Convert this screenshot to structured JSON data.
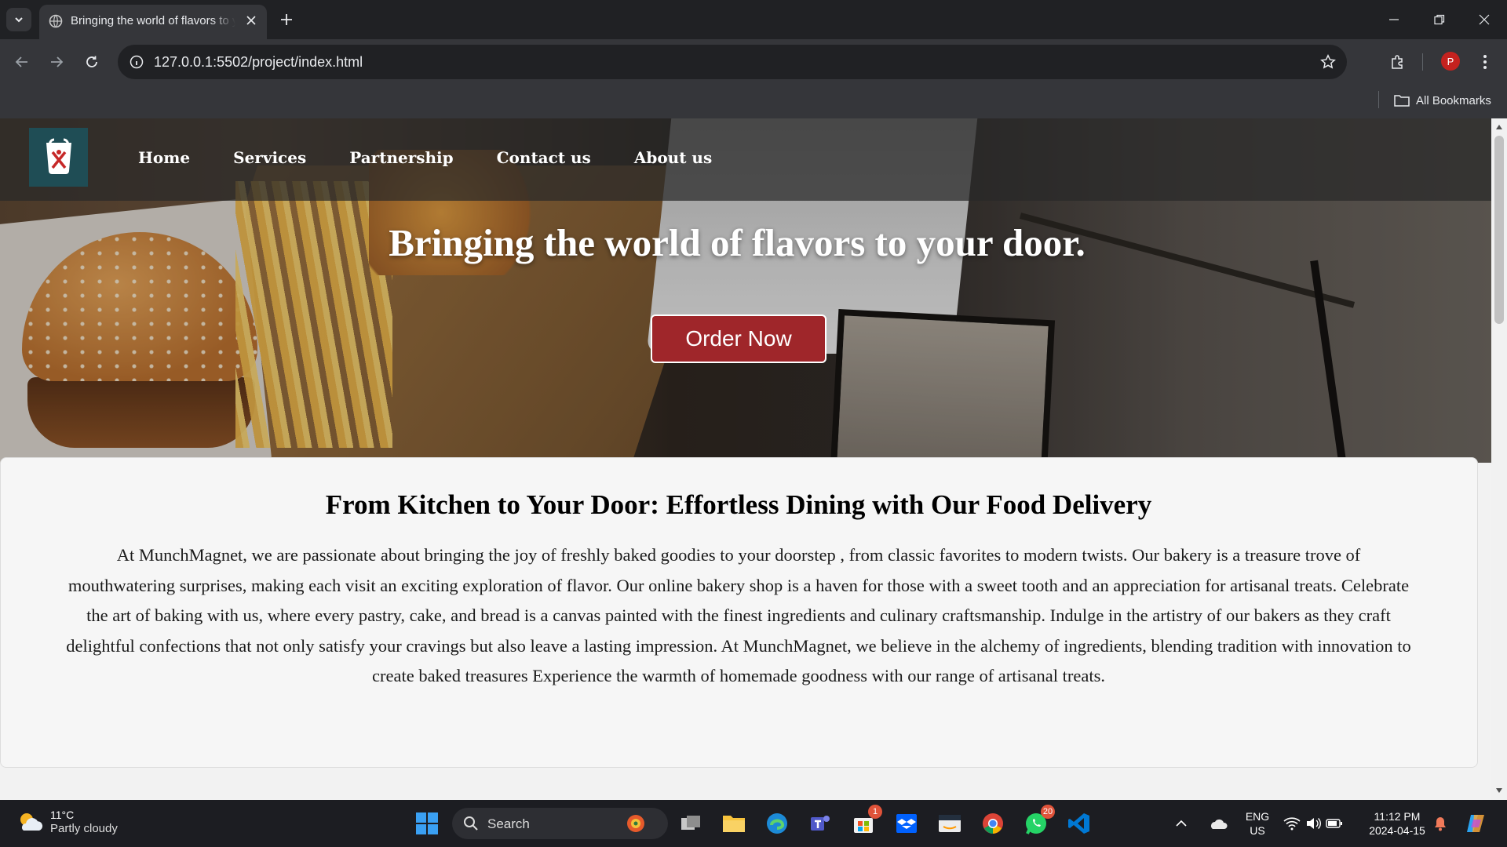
{
  "browser": {
    "tab_title": "Bringing the world of flavors to your door.",
    "url": "127.0.0.1:5502/project/index.html",
    "profile_initial": "P",
    "bookmarks_label": "All Bookmarks"
  },
  "site": {
    "nav": [
      "Home",
      "Services",
      "Partnership",
      "Contact us",
      "About us"
    ],
    "hero_title": "Bringing the world of flavors to your door.",
    "order_button": "Order Now",
    "section_title": "From Kitchen to Your Door: Effortless Dining with Our Food Delivery",
    "section_text": "At MunchMagnet, we are passionate about bringing the joy of freshly baked goodies to your doorstep , from classic favorites to modern twists. Our bakery is a treasure trove of mouthwatering surprises, making each visit an exciting exploration of flavor. Our online bakery shop is a haven for those with a sweet tooth and an appreciation for artisanal treats. Celebrate the art of baking with us, where every pastry, cake, and bread is a canvas painted with the finest ingredients and culinary craftsmanship. Indulge in the artistry of our bakers as they craft delightful confections that not only satisfy your cravings but also leave a lasting impression. At MunchMagnet, we believe in the alchemy of ingredients, blending tradition with innovation to create baked treasures Experience the warmth of homemade goodness with our range of artisanal treats."
  },
  "taskbar": {
    "weather_temp": "11°C",
    "weather_desc": "Partly cloudy",
    "search_label": "Search",
    "store_badge": "1",
    "whatsapp_badge": "20",
    "lang_1": "ENG",
    "lang_2": "US",
    "time": "11:12 PM",
    "date": "2024-04-15"
  },
  "colors": {
    "accent_button": "#9f262a",
    "chrome_dark": "#202124",
    "chrome_toolbar": "#35363a"
  }
}
